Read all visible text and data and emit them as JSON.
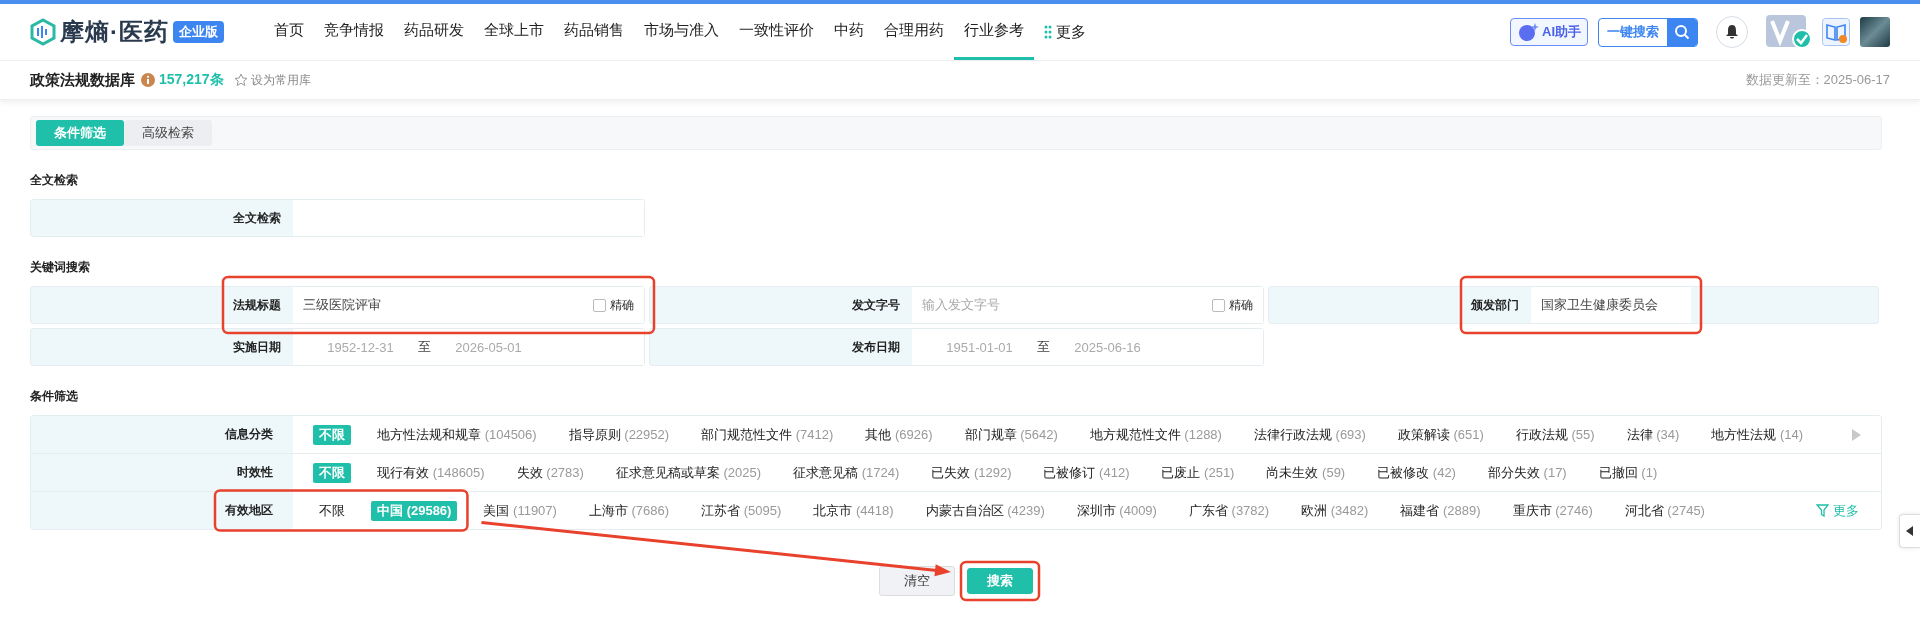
{
  "logo": {
    "name": "摩熵·医药",
    "badge": "企业版"
  },
  "nav": [
    {
      "label": "首页",
      "selected": false
    },
    {
      "label": "竞争情报",
      "selected": false
    },
    {
      "label": "药品研发",
      "selected": false
    },
    {
      "label": "全球上市",
      "selected": false
    },
    {
      "label": "药品销售",
      "selected": false
    },
    {
      "label": "市场与准入",
      "selected": false
    },
    {
      "label": "一致性评价",
      "selected": false
    },
    {
      "label": "中药",
      "selected": false
    },
    {
      "label": "合理用药",
      "selected": false
    },
    {
      "label": "行业参考",
      "selected": true
    }
  ],
  "nav_more": "更多",
  "header_actions": {
    "ai": "AI助手",
    "search": "一键搜索"
  },
  "page": {
    "title": "政策法规数据库",
    "count": "157,217条",
    "favorite": "设为常用库",
    "updated": "数据更新至：2025-06-17"
  },
  "tabs": [
    {
      "label": "条件筛选",
      "selected": true
    },
    {
      "label": "高级检索",
      "selected": false
    }
  ],
  "fulltext": {
    "heading": "全文检索",
    "label": "全文检索"
  },
  "keyword": {
    "heading": "关键词搜索",
    "fields": [
      {
        "kind": "text",
        "label": "法规标题",
        "value": "三级医院评审",
        "exact_label": "精确",
        "exact": false,
        "highlighted": true
      },
      {
        "kind": "text",
        "label": "发文字号",
        "placeholder": "输入发文字号",
        "exact_label": "精确",
        "exact": false,
        "highlighted": false
      },
      {
        "kind": "select",
        "label": "颁发部门",
        "value": "国家卫生健康委员会",
        "highlighted": true
      },
      {
        "kind": "range",
        "label": "实施日期",
        "from": "1952-12-31",
        "sep": "至",
        "to": "2026-05-01",
        "highlighted": false
      },
      {
        "kind": "range",
        "label": "发布日期",
        "from": "1951-01-01",
        "sep": "至",
        "to": "2025-06-16",
        "highlighted": false
      }
    ]
  },
  "filters": {
    "heading": "条件筛选",
    "rows": [
      {
        "label": "信息分类",
        "highlighted": false,
        "has_next": true,
        "options": [
          {
            "name": "不限",
            "selected": true
          },
          {
            "name": "地方性法规和规章",
            "count": "(104506)",
            "selected": false
          },
          {
            "name": "指导原则",
            "count": "(22952)",
            "selected": false
          },
          {
            "name": "部门规范性文件",
            "count": "(7412)",
            "selected": false
          },
          {
            "name": "其他",
            "count": "(6926)",
            "selected": false
          },
          {
            "name": "部门规章",
            "count": "(5642)",
            "selected": false
          },
          {
            "name": "地方规范性文件",
            "count": "(1288)",
            "selected": false
          },
          {
            "name": "法律行政法规",
            "count": "(693)",
            "selected": false
          },
          {
            "name": "政策解读",
            "count": "(651)",
            "selected": false
          },
          {
            "name": "行政法规",
            "count": "(55)",
            "selected": false
          },
          {
            "name": "法律",
            "count": "(34)",
            "selected": false
          },
          {
            "name": "地方性法规",
            "count": "(14)",
            "selected": false
          }
        ]
      },
      {
        "label": "时效性",
        "highlighted": false,
        "has_next": false,
        "options": [
          {
            "name": "不限",
            "selected": true
          },
          {
            "name": "现行有效",
            "count": "(148605)",
            "selected": false
          },
          {
            "name": "失效",
            "count": "(2783)",
            "selected": false
          },
          {
            "name": "征求意见稿或草案",
            "count": "(2025)",
            "selected": false
          },
          {
            "name": "征求意见稿",
            "count": "(1724)",
            "selected": false
          },
          {
            "name": "已失效",
            "count": "(1292)",
            "selected": false
          },
          {
            "name": "已被修订",
            "count": "(412)",
            "selected": false
          },
          {
            "name": "已废止",
            "count": "(251)",
            "selected": false
          },
          {
            "name": "尚未生效",
            "count": "(59)",
            "selected": false
          },
          {
            "name": "已被修改",
            "count": "(42)",
            "selected": false
          },
          {
            "name": "部分失效",
            "count": "(17)",
            "selected": false
          },
          {
            "name": "已撤回",
            "count": "(1)",
            "selected": false
          }
        ]
      },
      {
        "label": "有效地区",
        "highlighted": true,
        "has_next": false,
        "more": "更多",
        "options": [
          {
            "name": "不限",
            "selected": false
          },
          {
            "name": "中国",
            "count": "(29586)",
            "selected": true
          },
          {
            "name": "美国",
            "count": "(11907)",
            "selected": false
          },
          {
            "name": "上海市",
            "count": "(7686)",
            "selected": false
          },
          {
            "name": "江苏省",
            "count": "(5095)",
            "selected": false
          },
          {
            "name": "北京市",
            "count": "(4418)",
            "selected": false
          },
          {
            "name": "内蒙古自治区",
            "count": "(4239)",
            "selected": false
          },
          {
            "name": "深圳市",
            "count": "(4009)",
            "selected": false
          },
          {
            "name": "广东省",
            "count": "(3782)",
            "selected": false
          },
          {
            "name": "欧洲",
            "count": "(3482)",
            "selected": false
          },
          {
            "name": "福建省",
            "count": "(2889)",
            "selected": false
          },
          {
            "name": "重庆市",
            "count": "(2746)",
            "selected": false
          },
          {
            "name": "河北省",
            "count": "(2745)",
            "selected": false
          }
        ]
      }
    ]
  },
  "buttons": [
    {
      "label": "清空",
      "kind": "secondary",
      "highlighted": false
    },
    {
      "label": "搜索",
      "kind": "primary",
      "highlighted": true
    }
  ],
  "arrow_shown": true
}
